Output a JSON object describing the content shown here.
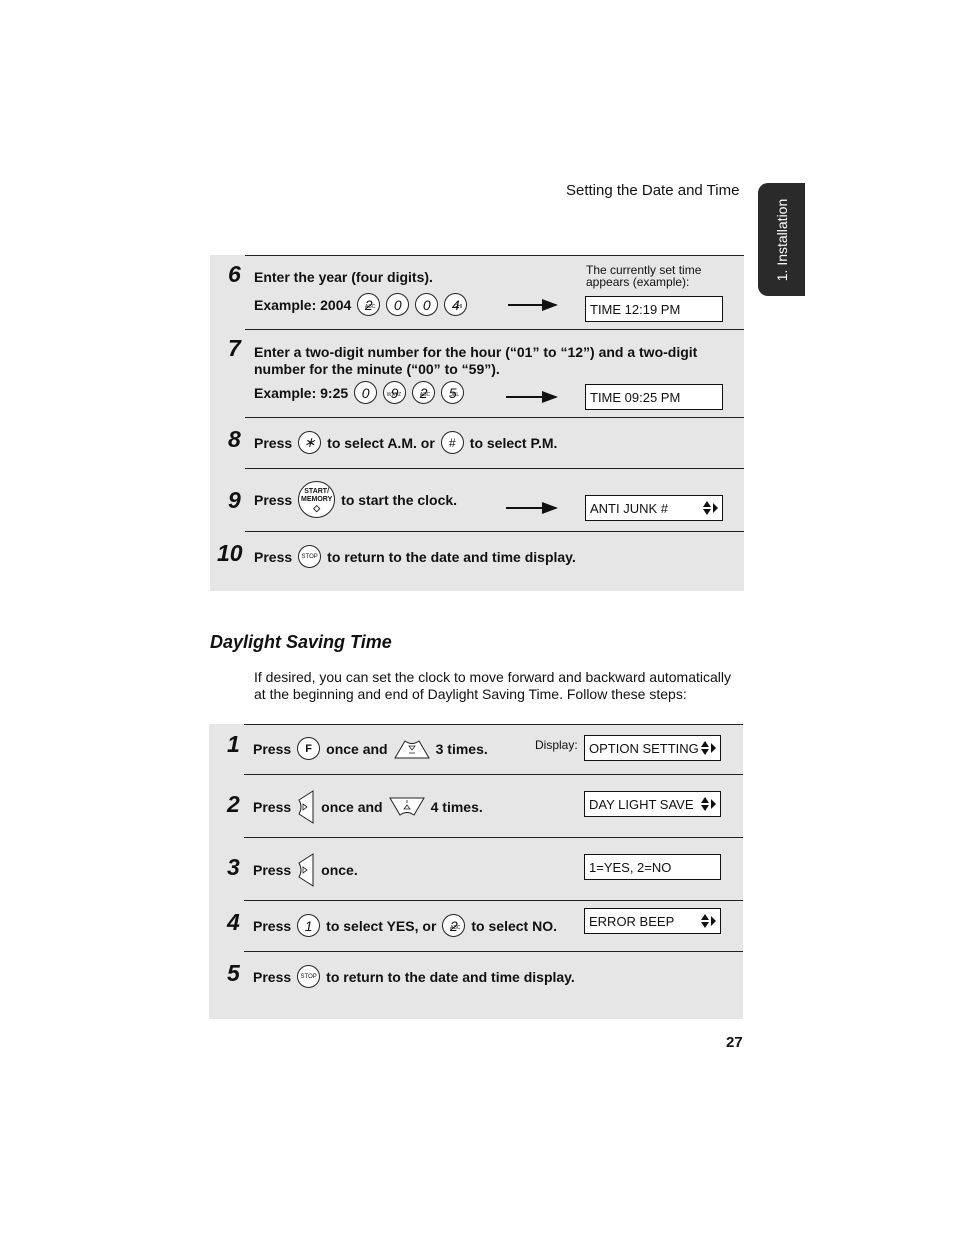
{
  "header": {
    "running_title": "Setting the Date and Time",
    "side_tab": "1. Installation",
    "page_number": "27"
  },
  "clock_steps": [
    {
      "number": "6",
      "line1": "Enter the year (four digits).",
      "example_label": "Example: 2004",
      "keys": [
        {
          "main": "2",
          "sub": "ABC"
        },
        {
          "main": "0",
          "sub": ""
        },
        {
          "main": "0",
          "sub": ""
        },
        {
          "main": "4",
          "sub": "GHI"
        }
      ],
      "caption": "The currently set time appears (example):",
      "display": "TIME 12:19 PM"
    },
    {
      "number": "7",
      "line1": "Enter a two-digit number for the hour (“01” to “12”) and a two-digit",
      "line2": "number for the minute (“00” to “59”).",
      "example_label": "Example: 9:25",
      "keys": [
        {
          "main": "0",
          "sub": ""
        },
        {
          "main": "9",
          "sub": "WXYZ"
        },
        {
          "main": "2",
          "sub": "ABC"
        },
        {
          "main": "5",
          "sub": "JKL"
        }
      ],
      "display": "TIME 09:25 PM"
    },
    {
      "number": "8",
      "press": "Press",
      "key_am": "∗",
      "mid": "to select A.M. or",
      "key_pm": "#",
      "end": "to select P.M."
    },
    {
      "number": "9",
      "press": "Press",
      "key_label_1": "START/",
      "key_label_2": "MEMORY",
      "key_symbol": "◇",
      "end": "to start the clock.",
      "display": "ANTI JUNK #"
    },
    {
      "number": "10",
      "press": "Press",
      "key": "STOP",
      "end": "to return to the date and time display."
    }
  ],
  "dst_section": {
    "title": "Daylight Saving Time",
    "intro_line1": "If desired, you can set the clock to move forward and backward automatically",
    "intro_line2": "at the beginning and end of Daylight Saving Time. Follow these steps:",
    "display_label": "Display:",
    "steps": [
      {
        "number": "1",
        "press": "Press",
        "key": "F",
        "mid": "once and",
        "end": "3 times.",
        "display": "OPTION SETTING"
      },
      {
        "number": "2",
        "press": "Press",
        "mid": "once and",
        "end": "4 times.",
        "display": "DAY LIGHT SAVE"
      },
      {
        "number": "3",
        "press": "Press",
        "end": "once.",
        "display": "1=YES, 2=NO"
      },
      {
        "number": "4",
        "press": "Press",
        "key_yes": "1",
        "mid": "to select YES, or",
        "key_no": "2",
        "key_no_sub": "ABC",
        "end": "to select NO.",
        "display": "ERROR BEEP"
      },
      {
        "number": "5",
        "press": "Press",
        "key": "STOP",
        "end": "to return to the date and time display."
      }
    ]
  },
  "colors": {
    "panel_bg": "#e6e6e6",
    "tab_bg": "#2a2a2a",
    "text": "#111111"
  }
}
